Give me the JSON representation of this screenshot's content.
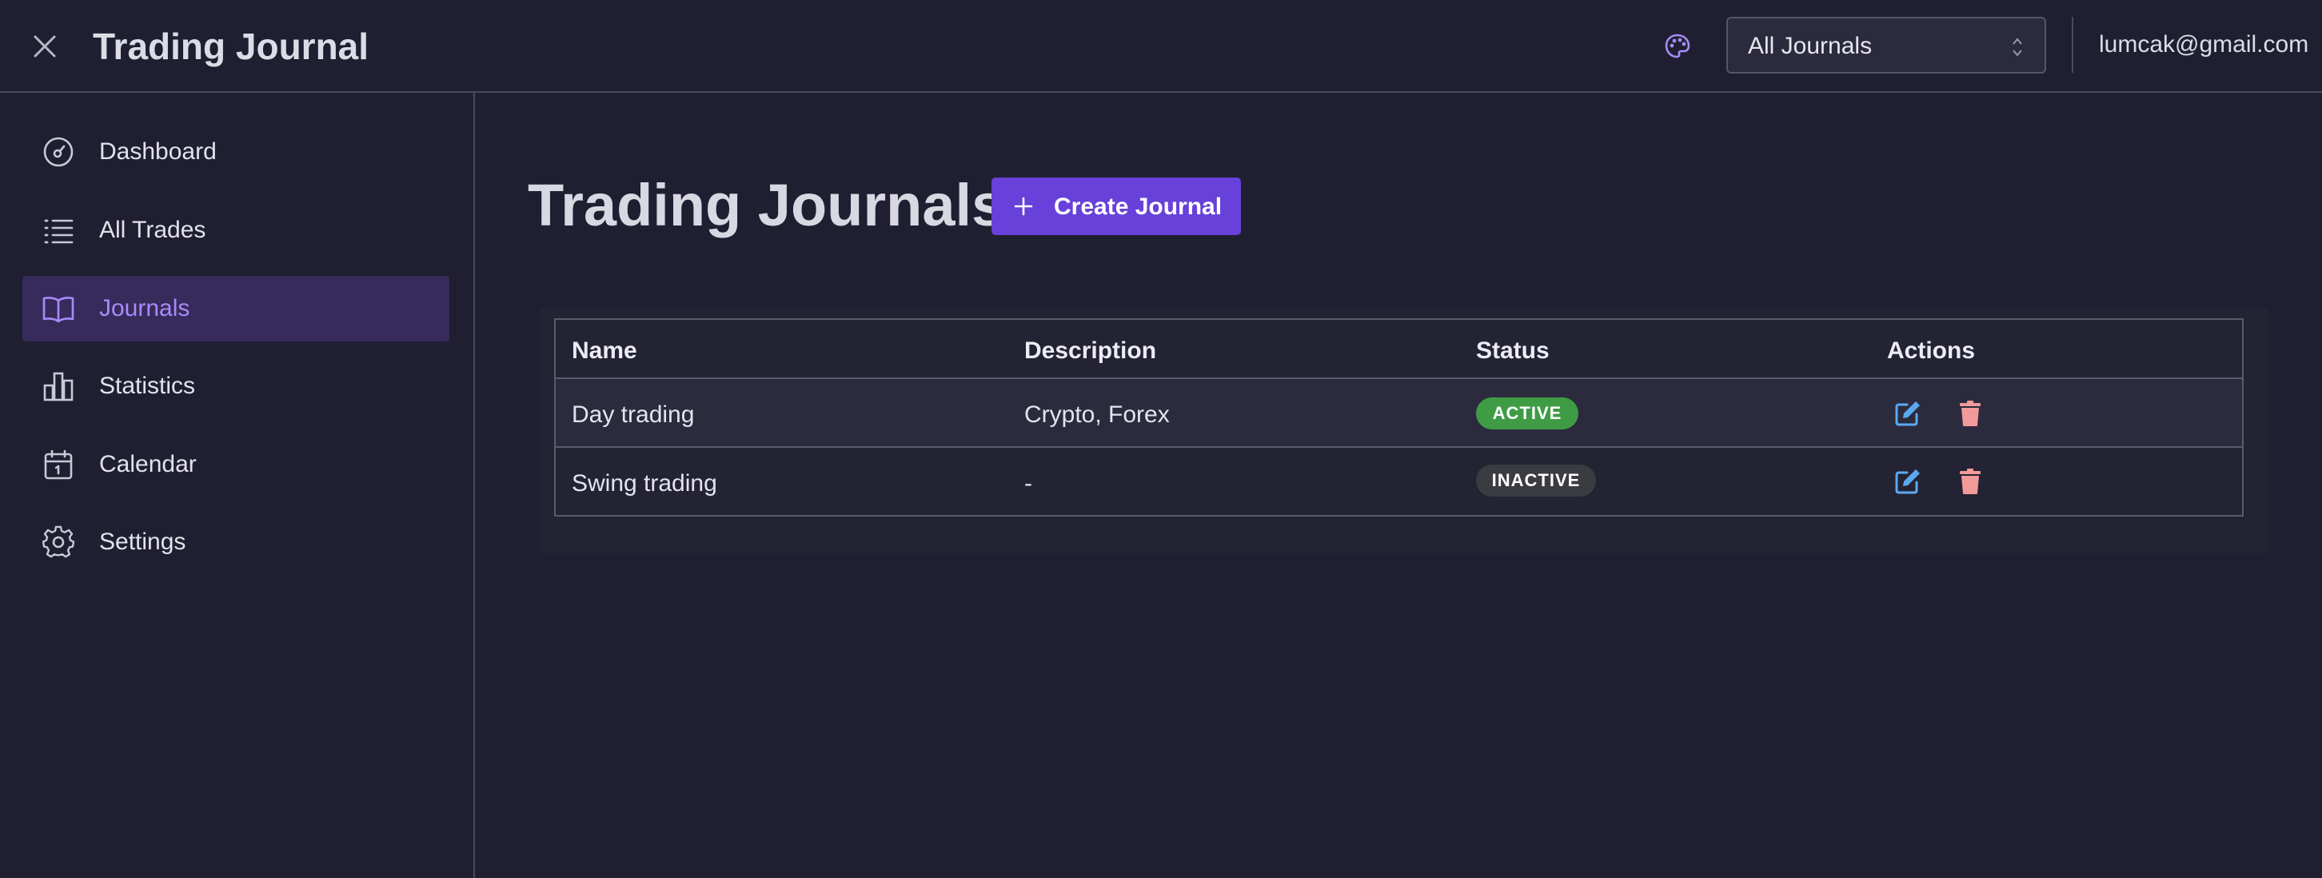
{
  "header": {
    "title": "Trading Journal",
    "journal_select": {
      "value": "All Journals"
    },
    "user_email": "lumcak@gmail.com"
  },
  "sidebar": {
    "items": [
      {
        "label": "Dashboard",
        "icon": "gauge-icon",
        "active": false
      },
      {
        "label": "All Trades",
        "icon": "list-icon",
        "active": false
      },
      {
        "label": "Journals",
        "icon": "book-open-icon",
        "active": true
      },
      {
        "label": "Statistics",
        "icon": "bar-chart-icon",
        "active": false
      },
      {
        "label": "Calendar",
        "icon": "calendar-icon",
        "active": false
      },
      {
        "label": "Settings",
        "icon": "gear-icon",
        "active": false
      }
    ]
  },
  "main": {
    "title": "Trading Journals",
    "create_button": "Create Journal",
    "table": {
      "columns": [
        "Name",
        "Description",
        "Status",
        "Actions"
      ],
      "rows": [
        {
          "name": "Day trading",
          "description": "Crypto, Forex",
          "status": "ACTIVE"
        },
        {
          "name": "Swing trading",
          "description": "-",
          "status": "INACTIVE"
        }
      ]
    }
  },
  "colors": {
    "background": "#201f31",
    "accent": "#6741d9",
    "active_nav_bg": "#372b5c",
    "active_nav_text": "#a78bfa",
    "status_active": "#3f9c45",
    "status_inactive": "#3b3c41",
    "edit_icon": "#5aa9f0",
    "delete_icon": "#f29a9a"
  }
}
